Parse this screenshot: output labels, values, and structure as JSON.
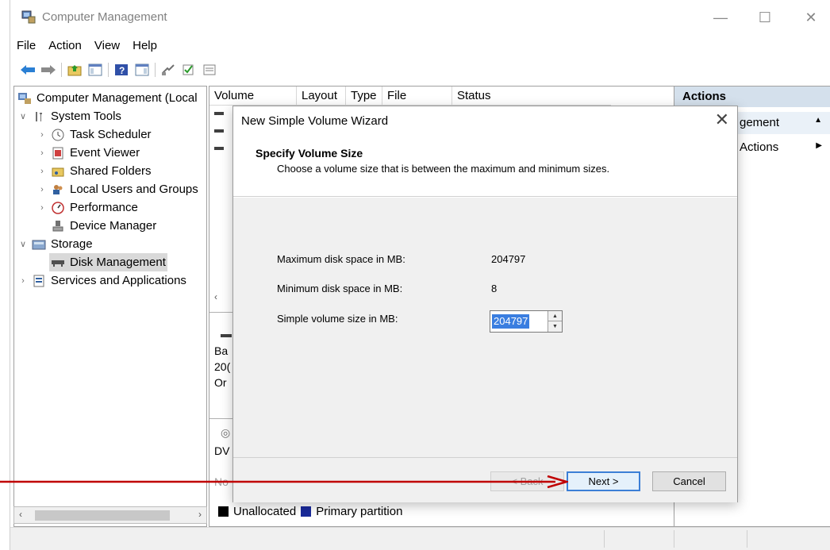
{
  "window": {
    "title": "Computer Management",
    "menu": [
      "File",
      "Action",
      "View",
      "Help"
    ]
  },
  "tree": {
    "root": "Computer Management (Local",
    "items": [
      {
        "label": "System Tools",
        "icon": "tools-icon"
      },
      {
        "label": "Task Scheduler",
        "icon": "clock-icon"
      },
      {
        "label": "Event Viewer",
        "icon": "event-viewer-icon"
      },
      {
        "label": "Shared Folders",
        "icon": "shared-folders-icon"
      },
      {
        "label": "Local Users and Groups",
        "icon": "users-icon"
      },
      {
        "label": "Performance",
        "icon": "performance-icon"
      },
      {
        "label": "Device Manager",
        "icon": "device-manager-icon"
      },
      {
        "label": "Storage",
        "icon": "storage-icon"
      },
      {
        "label": "Disk Management",
        "icon": "disk-icon"
      },
      {
        "label": "Services and Applications",
        "icon": "services-icon"
      }
    ]
  },
  "table": {
    "columns": [
      "Volume",
      "Layout",
      "Type",
      "File System",
      "Status"
    ]
  },
  "disk_panel": {
    "lines": [
      "Ba",
      "20(",
      "Or"
    ],
    "dvd": "DV",
    "no": "No"
  },
  "legend": {
    "unallocated": "Unallocated",
    "primary": "Primary partition",
    "unallocated_color": "#000000",
    "primary_color": "#1a2a9a"
  },
  "actions": {
    "header": "Actions",
    "item1": "gement",
    "item2": "Actions"
  },
  "dialog": {
    "title": "New Simple Volume Wizard",
    "heading": "Specify Volume Size",
    "subheading": "Choose a volume size that is between the maximum and minimum sizes.",
    "max_label": "Maximum disk space in MB:",
    "max_value": "204797",
    "min_label": "Minimum disk space in MB:",
    "min_value": "8",
    "size_label": "Simple volume size in MB:",
    "size_value": "204797",
    "back_label": "< Back",
    "next_label": "Next >",
    "cancel_label": "Cancel"
  },
  "colors": {
    "annotation_arrow": "#c00000",
    "selection": "#3a7ee0"
  }
}
